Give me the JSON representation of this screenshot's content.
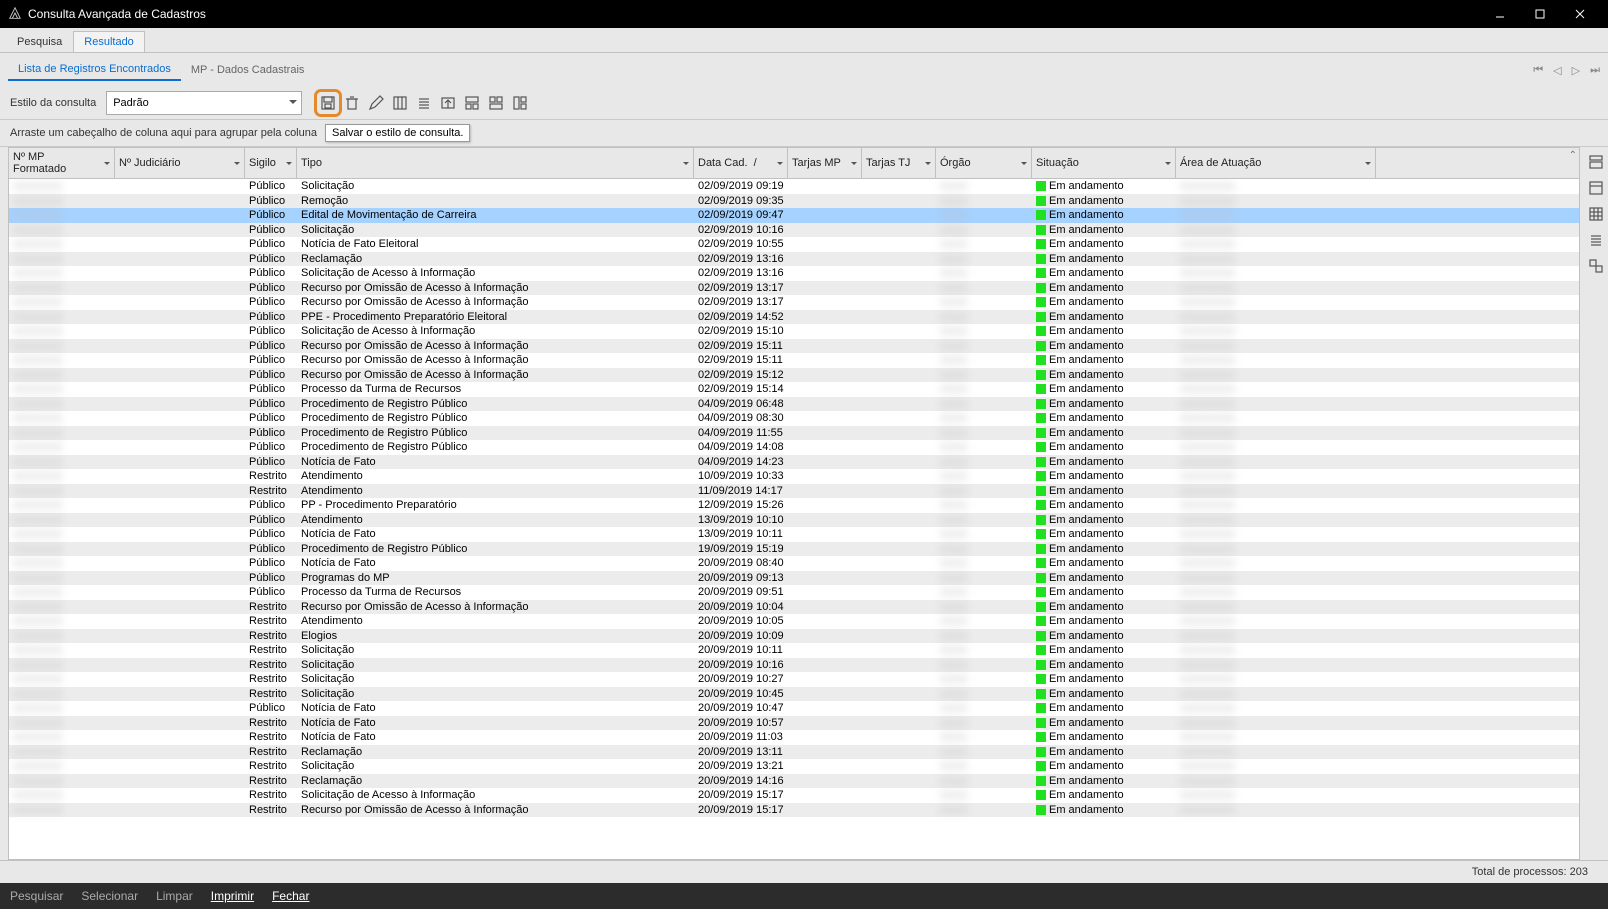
{
  "titlebar": {
    "title": "Consulta Avançada de Cadastros"
  },
  "main_tabs": [
    "Pesquisa",
    "Resultado"
  ],
  "sub_tabs": [
    "Lista de Registros Encontrados",
    "MP - Dados Cadastrais"
  ],
  "toolbar": {
    "style_label": "Estilo da consulta",
    "style_value": "Padrão"
  },
  "group_hint": "Arraste um cabeçalho de coluna aqui para agrupar pela coluna",
  "tooltip": "Salvar o estilo de consulta.",
  "columns": [
    "Nº MP Formatado",
    "Nº Judiciário",
    "Sigilo",
    "Tipo",
    "Data Cad.",
    "Tarjas MP",
    "Tarjas TJ",
    "Órgão",
    "Situação",
    "Área de Atuação"
  ],
  "status": {
    "label": "Total de processos:",
    "count": "203"
  },
  "footer": [
    "Pesquisar",
    "Selecionar",
    "Limpar",
    "Imprimir",
    "Fechar"
  ],
  "selected_index": 2,
  "rows": [
    {
      "sigilo": "Público",
      "tipo": "Solicitação",
      "data": "02/09/2019 09:19",
      "situacao": "Em andamento"
    },
    {
      "sigilo": "Público",
      "tipo": "Remoção",
      "data": "02/09/2019 09:35",
      "situacao": "Em andamento"
    },
    {
      "sigilo": "Público",
      "tipo": "Edital de Movimentação de Carreira",
      "data": "02/09/2019 09:47",
      "situacao": "Em andamento"
    },
    {
      "sigilo": "Público",
      "tipo": "Solicitação",
      "data": "02/09/2019 10:16",
      "situacao": "Em andamento"
    },
    {
      "sigilo": "Público",
      "tipo": "Notícia de Fato Eleitoral",
      "data": "02/09/2019 10:55",
      "situacao": "Em andamento"
    },
    {
      "sigilo": "Público",
      "tipo": "Reclamação",
      "data": "02/09/2019 13:16",
      "situacao": "Em andamento"
    },
    {
      "sigilo": "Público",
      "tipo": "Solicitação de Acesso à Informação",
      "data": "02/09/2019 13:16",
      "situacao": "Em andamento"
    },
    {
      "sigilo": "Público",
      "tipo": "Recurso por Omissão de Acesso à Informação",
      "data": "02/09/2019 13:17",
      "situacao": "Em andamento"
    },
    {
      "sigilo": "Público",
      "tipo": "Recurso por Omissão de Acesso à Informação",
      "data": "02/09/2019 13:17",
      "situacao": "Em andamento"
    },
    {
      "sigilo": "Público",
      "tipo": "PPE - Procedimento Preparatório Eleitoral",
      "data": "02/09/2019 14:52",
      "situacao": "Em andamento"
    },
    {
      "sigilo": "Público",
      "tipo": "Solicitação de Acesso à Informação",
      "data": "02/09/2019 15:10",
      "situacao": "Em andamento"
    },
    {
      "sigilo": "Público",
      "tipo": "Recurso por Omissão de Acesso à Informação",
      "data": "02/09/2019 15:11",
      "situacao": "Em andamento"
    },
    {
      "sigilo": "Público",
      "tipo": "Recurso por Omissão de Acesso à Informação",
      "data": "02/09/2019 15:11",
      "situacao": "Em andamento"
    },
    {
      "sigilo": "Público",
      "tipo": "Recurso por Omissão de Acesso à Informação",
      "data": "02/09/2019 15:12",
      "situacao": "Em andamento"
    },
    {
      "sigilo": "Público",
      "tipo": "Processo da Turma de Recursos",
      "data": "02/09/2019 15:14",
      "situacao": "Em andamento"
    },
    {
      "sigilo": "Público",
      "tipo": "Procedimento de Registro Público",
      "data": "04/09/2019 06:48",
      "situacao": "Em andamento"
    },
    {
      "sigilo": "Público",
      "tipo": "Procedimento de Registro Público",
      "data": "04/09/2019 08:30",
      "situacao": "Em andamento"
    },
    {
      "sigilo": "Público",
      "tipo": "Procedimento de Registro Público",
      "data": "04/09/2019 11:55",
      "situacao": "Em andamento"
    },
    {
      "sigilo": "Público",
      "tipo": "Procedimento de Registro Público",
      "data": "04/09/2019 14:08",
      "situacao": "Em andamento"
    },
    {
      "sigilo": "Público",
      "tipo": "Notícia de Fato",
      "data": "04/09/2019 14:23",
      "situacao": "Em andamento"
    },
    {
      "sigilo": "Restrito",
      "tipo": "Atendimento",
      "data": "10/09/2019 10:33",
      "situacao": "Em andamento"
    },
    {
      "sigilo": "Restrito",
      "tipo": "Atendimento",
      "data": "11/09/2019 14:17",
      "situacao": "Em andamento"
    },
    {
      "sigilo": "Público",
      "tipo": "PP - Procedimento Preparatório",
      "data": "12/09/2019 15:26",
      "situacao": "Em andamento"
    },
    {
      "sigilo": "Público",
      "tipo": "Atendimento",
      "data": "13/09/2019 10:10",
      "situacao": "Em andamento"
    },
    {
      "sigilo": "Público",
      "tipo": "Notícia de Fato",
      "data": "13/09/2019 10:11",
      "situacao": "Em andamento"
    },
    {
      "sigilo": "Público",
      "tipo": "Procedimento de Registro Público",
      "data": "19/09/2019 15:19",
      "situacao": "Em andamento"
    },
    {
      "sigilo": "Público",
      "tipo": "Notícia de Fato",
      "data": "20/09/2019 08:40",
      "situacao": "Em andamento"
    },
    {
      "sigilo": "Público",
      "tipo": "Programas do MP",
      "data": "20/09/2019 09:13",
      "situacao": "Em andamento"
    },
    {
      "sigilo": "Público",
      "tipo": "Processo da Turma de Recursos",
      "data": "20/09/2019 09:51",
      "situacao": "Em andamento"
    },
    {
      "sigilo": "Restrito",
      "tipo": "Recurso por Omissão de Acesso à Informação",
      "data": "20/09/2019 10:04",
      "situacao": "Em andamento"
    },
    {
      "sigilo": "Restrito",
      "tipo": "Atendimento",
      "data": "20/09/2019 10:05",
      "situacao": "Em andamento"
    },
    {
      "sigilo": "Restrito",
      "tipo": "Elogios",
      "data": "20/09/2019 10:09",
      "situacao": "Em andamento"
    },
    {
      "sigilo": "Restrito",
      "tipo": "Solicitação",
      "data": "20/09/2019 10:11",
      "situacao": "Em andamento"
    },
    {
      "sigilo": "Restrito",
      "tipo": "Solicitação",
      "data": "20/09/2019 10:16",
      "situacao": "Em andamento"
    },
    {
      "sigilo": "Restrito",
      "tipo": "Solicitação",
      "data": "20/09/2019 10:27",
      "situacao": "Em andamento"
    },
    {
      "sigilo": "Restrito",
      "tipo": "Solicitação",
      "data": "20/09/2019 10:45",
      "situacao": "Em andamento"
    },
    {
      "sigilo": "Público",
      "tipo": "Notícia de Fato",
      "data": "20/09/2019 10:47",
      "situacao": "Em andamento"
    },
    {
      "sigilo": "Restrito",
      "tipo": "Notícia de Fato",
      "data": "20/09/2019 10:57",
      "situacao": "Em andamento"
    },
    {
      "sigilo": "Restrito",
      "tipo": "Notícia de Fato",
      "data": "20/09/2019 11:03",
      "situacao": "Em andamento"
    },
    {
      "sigilo": "Restrito",
      "tipo": "Reclamação",
      "data": "20/09/2019 13:11",
      "situacao": "Em andamento"
    },
    {
      "sigilo": "Restrito",
      "tipo": "Solicitação",
      "data": "20/09/2019 13:21",
      "situacao": "Em andamento"
    },
    {
      "sigilo": "Restrito",
      "tipo": "Reclamação",
      "data": "20/09/2019 14:16",
      "situacao": "Em andamento"
    },
    {
      "sigilo": "Restrito",
      "tipo": "Solicitação de Acesso à Informação",
      "data": "20/09/2019 15:17",
      "situacao": "Em andamento"
    },
    {
      "sigilo": "Restrito",
      "tipo": "Recurso por Omissão de Acesso à Informação",
      "data": "20/09/2019 15:17",
      "situacao": "Em andamento"
    }
  ]
}
